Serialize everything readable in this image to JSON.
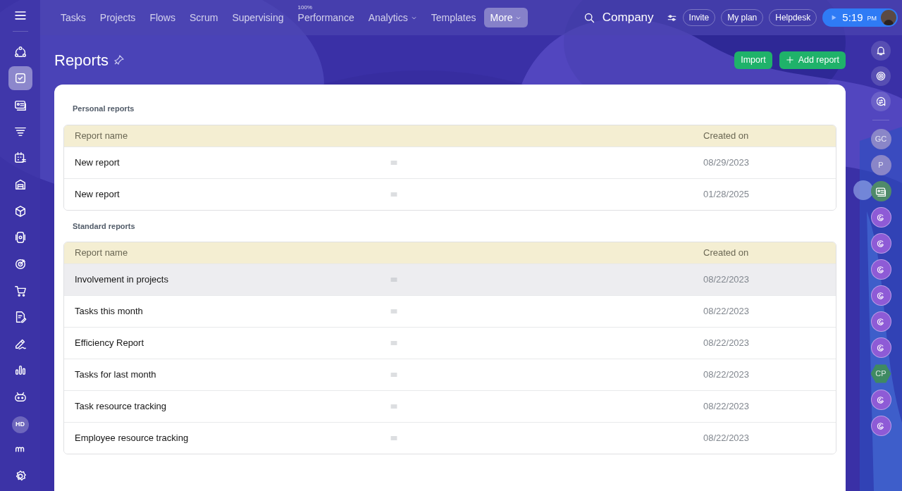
{
  "top_nav": {
    "items": [
      {
        "label": "Tasks",
        "selected": false,
        "dropdown": false
      },
      {
        "label": "Projects",
        "selected": false,
        "dropdown": false
      },
      {
        "label": "Flows",
        "selected": false,
        "dropdown": false
      },
      {
        "label": "Scrum",
        "selected": false,
        "dropdown": false
      },
      {
        "label": "Supervising",
        "selected": false,
        "dropdown": false
      },
      {
        "label": "Performance",
        "selected": false,
        "dropdown": false,
        "badge": "100%"
      },
      {
        "label": "Analytics",
        "selected": false,
        "dropdown": true
      },
      {
        "label": "Templates",
        "selected": false,
        "dropdown": false
      },
      {
        "label": "More",
        "selected": true,
        "dropdown": true
      }
    ],
    "company": "Company",
    "buttons": [
      "Invite",
      "My plan",
      "Helpdesk"
    ],
    "clock": {
      "time": "5:19",
      "period": "PM"
    }
  },
  "left_sidebar": {
    "items": [
      {
        "kind": "icon",
        "selected": false
      },
      {
        "kind": "icon",
        "selected": true
      },
      {
        "kind": "icon",
        "selected": false
      },
      {
        "kind": "icon",
        "selected": false
      },
      {
        "kind": "icon",
        "selected": false
      },
      {
        "kind": "icon",
        "selected": false
      },
      {
        "kind": "icon",
        "selected": false
      },
      {
        "kind": "icon",
        "selected": false
      },
      {
        "kind": "icon",
        "selected": false
      },
      {
        "kind": "icon",
        "selected": false
      },
      {
        "kind": "icon",
        "selected": false
      },
      {
        "kind": "icon",
        "selected": false
      },
      {
        "kind": "icon",
        "selected": false
      },
      {
        "kind": "icon",
        "selected": false
      },
      {
        "kind": "avatar",
        "text": "HD",
        "selected": false
      },
      {
        "kind": "icon",
        "selected": false
      },
      {
        "kind": "icon",
        "selected": false
      }
    ]
  },
  "page": {
    "title": "Reports",
    "actions": [
      "Import",
      "Add report"
    ]
  },
  "sections": [
    {
      "title": "Personal reports",
      "columns": [
        "Report name",
        "Created on"
      ],
      "rows": [
        {
          "name": "New report",
          "date": "08/29/2023",
          "selected": false
        },
        {
          "name": "New report",
          "date": "01/28/2025",
          "selected": false
        }
      ]
    },
    {
      "title": "Standard reports",
      "columns": [
        "Report name",
        "Created on"
      ],
      "rows": [
        {
          "name": "Involvement in projects",
          "date": "08/22/2023",
          "selected": true
        },
        {
          "name": "Tasks this month",
          "date": "08/22/2023",
          "selected": false
        },
        {
          "name": "Efficiency Report",
          "date": "08/22/2023",
          "selected": false
        },
        {
          "name": "Tasks for last month",
          "date": "08/22/2023",
          "selected": false
        },
        {
          "name": "Task resource tracking",
          "date": "08/22/2023",
          "selected": false
        },
        {
          "name": "Employee resource tracking",
          "date": "08/22/2023",
          "selected": false
        }
      ]
    }
  ],
  "right_rail": {
    "items": [
      {
        "kind": "icon"
      },
      {
        "kind": "icon"
      },
      {
        "kind": "icon"
      },
      {
        "kind": "avatar",
        "text": "GC",
        "color": "#8a86c8"
      },
      {
        "kind": "avatar",
        "text": "P",
        "color": "#8a86c8"
      },
      {
        "kind": "card",
        "color": "#4f8a6a"
      },
      {
        "kind": "channel",
        "color": "#8e5bd6"
      },
      {
        "kind": "channel",
        "color": "#8e5bd6"
      },
      {
        "kind": "channel",
        "color": "#8e5bd6"
      },
      {
        "kind": "channel",
        "color": "#8e5bd6"
      },
      {
        "kind": "channel",
        "color": "#8e5bd6"
      },
      {
        "kind": "channel",
        "color": "#8e5bd6"
      },
      {
        "kind": "hex",
        "text": "CP",
        "color": "#3f8a62"
      },
      {
        "kind": "channel",
        "color": "#8e5bd6"
      },
      {
        "kind": "channel",
        "color": "#8e5bd6"
      }
    ]
  }
}
